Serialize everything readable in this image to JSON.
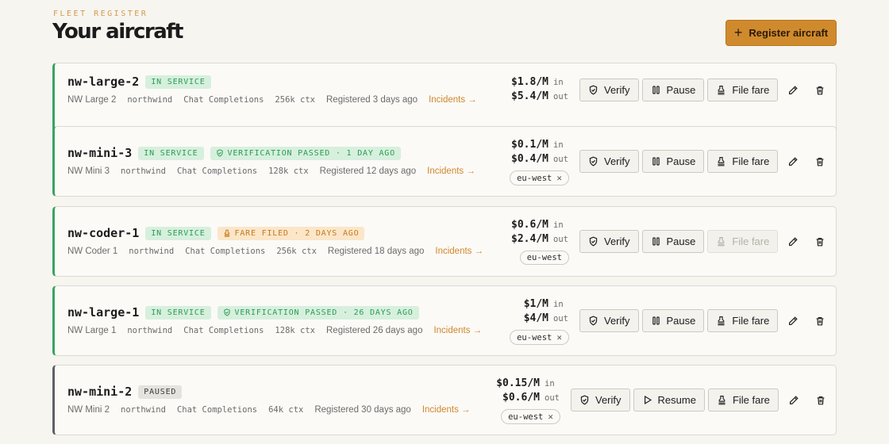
{
  "header": {
    "eyebrow": "FLEET REGISTER",
    "title": "Your aircraft",
    "register_label": "Register aircraft"
  },
  "labels": {
    "verify": "Verify",
    "pause": "Pause",
    "resume": "Resume",
    "file_fare": "File fare",
    "in": "in",
    "out": "out",
    "incidents": "Incidents →"
  },
  "aircraft": [
    {
      "name": "nw-large-2",
      "status": "IN SERVICE",
      "extra_badge": "",
      "display_name": "NW Large 2",
      "provider": "northwind",
      "api": "Chat Completions",
      "ctx": "256k ctx",
      "registered": "Registered 3 days ago",
      "price_in": "$1.8/M",
      "price_out": "$5.4/M",
      "region": ""
    },
    {
      "name": "nw-mini-3",
      "status": "IN SERVICE",
      "extra_badge": "VERIFICATION PASSED · 1 DAY AGO",
      "display_name": "NW Mini 3",
      "provider": "northwind",
      "api": "Chat Completions",
      "ctx": "128k ctx",
      "registered": "Registered 12 days ago",
      "price_in": "$0.1/M",
      "price_out": "$0.4/M",
      "region": "eu-west"
    },
    {
      "name": "nw-coder-1",
      "status": "IN SERVICE",
      "extra_badge": "FARE FILED · 2 DAYS AGO",
      "display_name": "NW Coder 1",
      "provider": "northwind",
      "api": "Chat Completions",
      "ctx": "256k ctx",
      "registered": "Registered 18 days ago",
      "price_in": "$0.6/M",
      "price_out": "$2.4/M",
      "region": "eu-west"
    },
    {
      "name": "nw-large-1",
      "status": "IN SERVICE",
      "extra_badge": "VERIFICATION PASSED · 26 DAYS AGO",
      "display_name": "NW Large 1",
      "provider": "northwind",
      "api": "Chat Completions",
      "ctx": "128k ctx",
      "registered": "Registered 26 days ago",
      "price_in": "$1/M",
      "price_out": "$4/M",
      "region": "eu-west"
    },
    {
      "name": "nw-mini-2",
      "status": "PAUSED",
      "extra_badge": "",
      "display_name": "NW Mini 2",
      "provider": "northwind",
      "api": "Chat Completions",
      "ctx": "64k ctx",
      "registered": "Registered 30 days ago",
      "price_in": "$0.15/M",
      "price_out": "$0.6/M",
      "region": "eu-west"
    }
  ],
  "colors": {
    "accent": "#d08a2e",
    "in_service": "#3aa45f",
    "paused": "#5d6066"
  },
  "icons": [
    "plus-icon",
    "shield-check-icon",
    "pause-icon",
    "play-icon",
    "stamp-icon",
    "pencil-icon",
    "trash-icon",
    "close-icon"
  ]
}
